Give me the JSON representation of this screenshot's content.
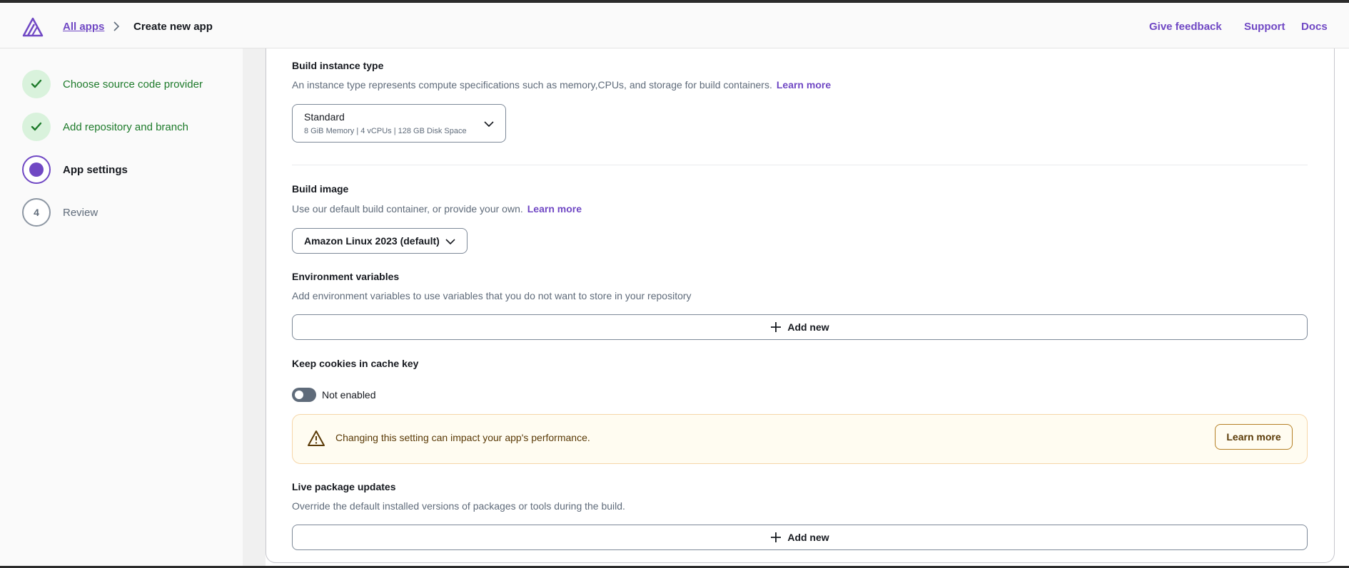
{
  "header": {
    "breadcrumb": {
      "link_label": "All apps",
      "current": "Create new app"
    },
    "links": {
      "feedback": "Give feedback",
      "support": "Support",
      "docs": "Docs"
    }
  },
  "steps": [
    {
      "label": "Choose source code provider",
      "state": "complete"
    },
    {
      "label": "Add repository and branch",
      "state": "complete"
    },
    {
      "label": "App settings",
      "state": "active"
    },
    {
      "label": "Review",
      "state": "pending",
      "number": "4"
    }
  ],
  "build_instance": {
    "title": "Build instance type",
    "description": "An instance type represents compute specifications such as memory,CPUs, and storage for build containers.",
    "learn_more": "Learn more",
    "selected": "Standard",
    "selected_detail": "8 GiB Memory | 4 vCPUs | 128 GB Disk Space"
  },
  "build_image": {
    "title": "Build image",
    "description": "Use our default build container, or provide your own.",
    "learn_more": "Learn more",
    "selected": "Amazon Linux 2023 (default)"
  },
  "env_vars": {
    "title": "Environment variables",
    "description": "Add environment variables to use variables that you do not want to store in your repository",
    "add_label": "Add new"
  },
  "cookies": {
    "title": "Keep cookies in cache key",
    "toggle_label": "Not enabled",
    "enabled": false,
    "alert_text": "Changing this setting can impact your app's performance.",
    "alert_button": "Learn more"
  },
  "live_packages": {
    "title": "Live package updates",
    "description": "Override the default installed versions of packages or tools during the build.",
    "add_label": "Add new"
  },
  "colors": {
    "accent": "#7048c4",
    "success": "#1d7a2a",
    "warning_bg": "#fffcf1",
    "warning_border": "#f6d6a8"
  }
}
